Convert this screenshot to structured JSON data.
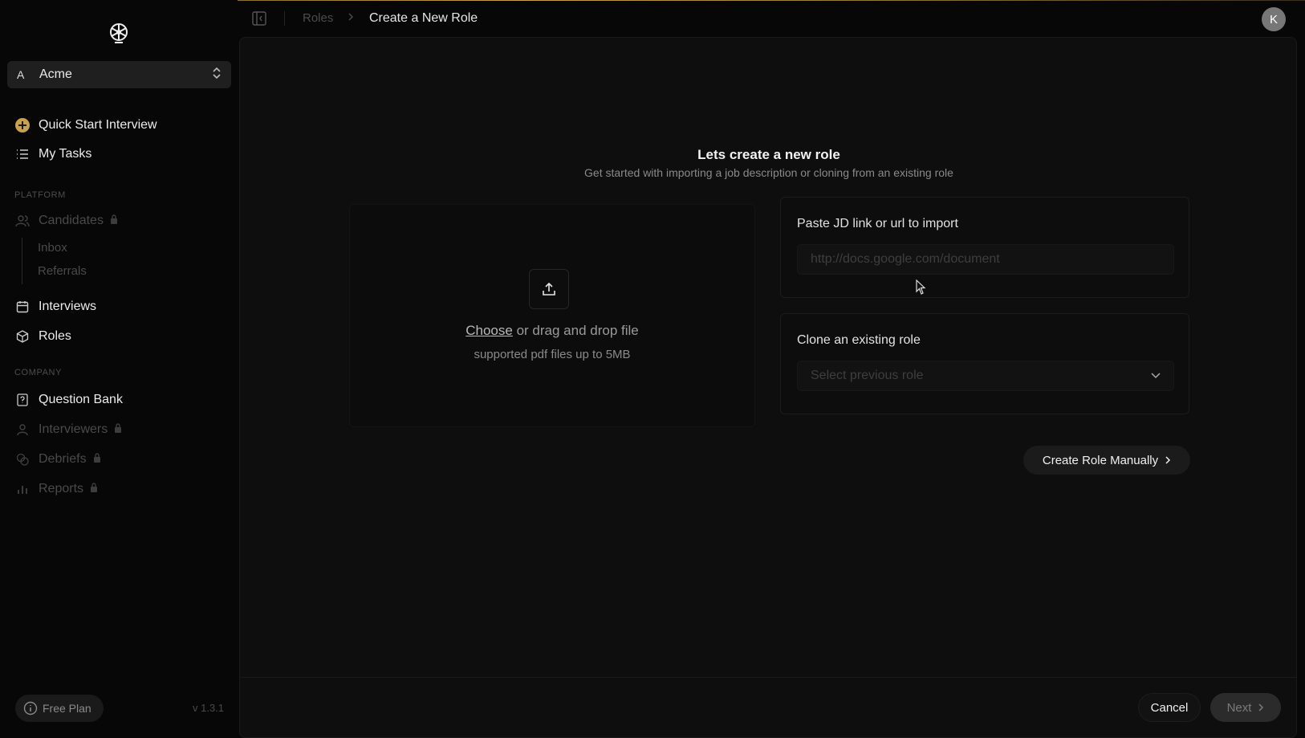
{
  "org": {
    "letter": "A",
    "name": "Acme"
  },
  "nav": {
    "quick_start": "Quick Start Interview",
    "my_tasks": "My Tasks",
    "platform_label": "PLATFORM",
    "candidates": "Candidates",
    "inbox": "Inbox",
    "referrals": "Referrals",
    "interviews": "Interviews",
    "roles": "Roles",
    "company_label": "COMPANY",
    "question_bank": "Question Bank",
    "interviewers": "Interviewers",
    "debriefs": "Debriefs",
    "reports": "Reports"
  },
  "plan": {
    "label": "Free Plan",
    "version": "v 1.3.1"
  },
  "breadcrumb": {
    "parent": "Roles",
    "current": "Create a New Role"
  },
  "user": {
    "initial": "K"
  },
  "main": {
    "title": "Lets create a new role",
    "subtitle": "Get started with importing a job description or cloning from an existing role",
    "upload": {
      "choose": "Choose",
      "rest": " or drag and drop file",
      "hint": "supported pdf files up to 5MB"
    },
    "import_card": {
      "label": "Paste JD link or url to import",
      "placeholder": "http://docs.google.com/document"
    },
    "clone_card": {
      "label": "Clone an existing role",
      "placeholder": "Select previous role"
    },
    "create_manual": "Create Role Manually"
  },
  "footer": {
    "cancel": "Cancel",
    "next": "Next"
  },
  "colors": {
    "accent": "#c8a24a",
    "background": "#070707",
    "panel": "#0e0e0e"
  }
}
